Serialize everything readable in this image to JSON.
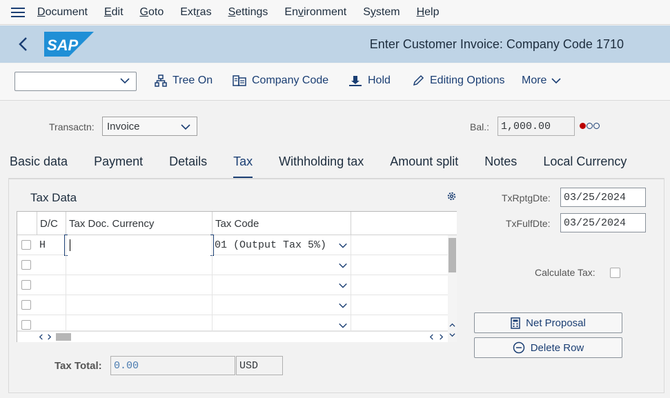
{
  "menubar": {
    "items": [
      "Document",
      "Edit",
      "Goto",
      "Extras",
      "Settings",
      "Environment",
      "System",
      "Help"
    ],
    "underline": [
      "D",
      "E",
      "G",
      "r",
      "S",
      "v",
      "y",
      "H"
    ]
  },
  "header": {
    "logo_text": "SAP",
    "title": "Enter Customer Invoice: Company Code 1710"
  },
  "toolbar": {
    "dropdown_value": "",
    "tree_on": "Tree On",
    "company_code": "Company Code",
    "hold": "Hold",
    "editing_options": "Editing Options",
    "more": "More"
  },
  "transaction": {
    "label": "Transactn:",
    "value": "Invoice",
    "balance_label": "Bal.:",
    "balance_value": "1,000.00",
    "status_colors": [
      "#bb0000",
      "#1a3e73",
      "#1a3e73"
    ]
  },
  "tabs": [
    "Basic data",
    "Payment",
    "Details",
    "Tax",
    "Withholding tax",
    "Amount split",
    "Notes",
    "Local Currency"
  ],
  "active_tab": "Tax",
  "tax_data": {
    "title": "Tax Data",
    "columns": [
      "D/C",
      "Tax Doc. Currency",
      "Tax Code"
    ],
    "rows": [
      {
        "dc": "H",
        "amount": "",
        "tax_code": "01 (Output Tax 5%)"
      },
      {
        "dc": "",
        "amount": "",
        "tax_code": ""
      },
      {
        "dc": "",
        "amount": "",
        "tax_code": ""
      },
      {
        "dc": "",
        "amount": "",
        "tax_code": ""
      },
      {
        "dc": "",
        "amount": "",
        "tax_code": ""
      }
    ],
    "tax_total_label": "Tax Total:",
    "tax_total_value": "0.00",
    "currency": "USD"
  },
  "right_panel": {
    "tx_rptg_label": "TxRptgDte:",
    "tx_rptg_value": "03/25/2024",
    "tx_fulf_label": "TxFulfDte:",
    "tx_fulf_value": "03/25/2024",
    "calc_tax_label": "Calculate Tax:",
    "net_proposal": "Net Proposal",
    "delete_row": "Delete Row"
  },
  "colors": {
    "header_bg": "#bfd4e6",
    "accent": "#1a3e73",
    "sap_logo": "#1f8fd6"
  }
}
